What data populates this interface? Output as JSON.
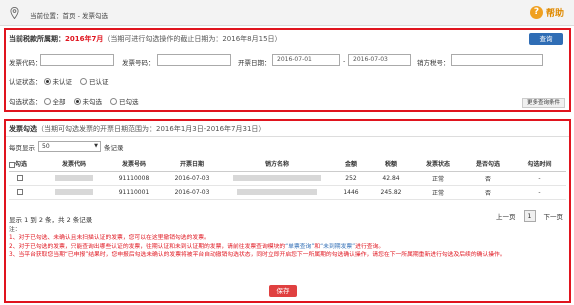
{
  "topbar": {
    "location": "当前位置：首页 - 发票勾选",
    "help_label": "帮助"
  },
  "period_panel": {
    "label": "当前税款所属期：",
    "period": "2016年7月",
    "note": "（当期可进行勾选操作的截止日期为：2016年8月15日）",
    "query_button": "查询",
    "fields": {
      "invoice_code_label": "发票代码：",
      "invoice_number_label": "发票号码：",
      "issue_date_label": "开票日期：",
      "date_from": "2016-07-01",
      "date_sep": "-",
      "date_to": "2016-07-03",
      "seller_tax_label": "销方税号："
    },
    "auth_status": {
      "label": "认证状态：",
      "options": [
        "未认证",
        "已认证"
      ],
      "selected": "未认证"
    },
    "check_status": {
      "label": "勾选状态：",
      "options": [
        "全部",
        "未勾选",
        "已勾选"
      ],
      "selected": "未勾选"
    },
    "more_button": "更多查询条件"
  },
  "list_panel": {
    "label": "发票勾选",
    "note": "（当期可勾选发票的开票日期范围为：2016年1月3日-2016年7月31日）",
    "per_page_prefix": "每页显示",
    "per_page_value": "50",
    "per_page_suffix": "条记录",
    "columns": [
      "勾选",
      "发票代码",
      "发票号码",
      "开票日期",
      "销方名称",
      "金额",
      "税额",
      "发票状态",
      "是否勾选",
      "勾选时间"
    ],
    "rows": [
      {
        "number": "91110008",
        "date": "2016-07-03",
        "amount": "252",
        "tax": "42.84",
        "status": "正常",
        "checked": "否",
        "time": "-"
      },
      {
        "number": "91110001",
        "date": "2016-07-03",
        "amount": "1446",
        "tax": "245.82",
        "status": "正常",
        "checked": "否",
        "time": "-"
      }
    ],
    "summary": "显示 1 到 2 条，共 2 条记录",
    "pager": {
      "prev": "上一页",
      "current": "1",
      "next": "下一页"
    },
    "notes": {
      "title": "注：",
      "line1": "1、对于已勾选、未确认且未扫描认证的发票，您可以在这里撤销勾选的发票。",
      "line2a": "2、对于已勾选的发票，只能查询出哪些认证的发票，往期认证和未到认证期的发票，请前往发票查询模块的",
      "line2b": "“单票查询”",
      "line2c": "和",
      "line2d": "“未到期发票”",
      "line2e": "进行查询。",
      "line3": "3、当平台获取您当期“已申报”结果时，您申报后勾选未确认的发票将被平台自动撤销勾选状态，同时立即开启您下一所属期的勾选确认操作，请您在下一所属期重新进行勾选及后续的确认操作。"
    },
    "save_button": "保存"
  }
}
